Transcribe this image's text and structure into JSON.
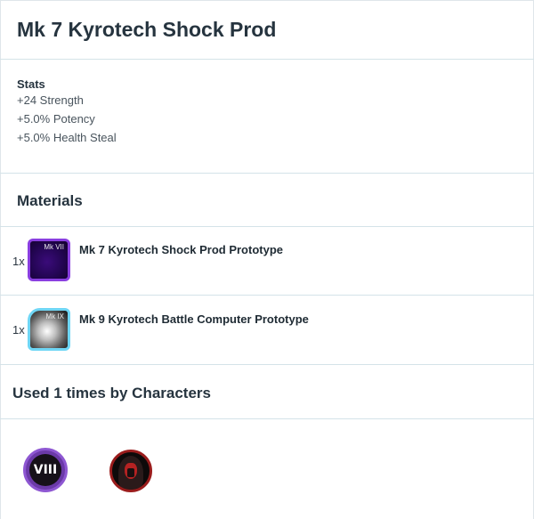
{
  "item": {
    "title": "Mk 7 Kyrotech Shock Prod"
  },
  "stats": {
    "heading": "Stats",
    "lines": [
      "+24 Strength",
      "+5.0% Potency",
      "+5.0% Health Steal"
    ]
  },
  "materials": {
    "heading": "Materials",
    "items": [
      {
        "quantity": "1x",
        "tier": "Mk VII",
        "name": "Mk 7 Kyrotech Shock Prod Prototype",
        "icon": "purple-gear-icon",
        "border_color": "#8a3fe0"
      },
      {
        "quantity": "1x",
        "tier": "Mk IX",
        "name": "Mk 9 Kyrotech Battle Computer Prototype",
        "icon": "blue-gear-icon",
        "border_color": "#6fd6f5"
      }
    ]
  },
  "used_by": {
    "heading": "Used 1 times by Characters",
    "characters": [
      {
        "badge": "VIII",
        "icon": "gear-tier-viii-icon",
        "color": "#8e57d2"
      },
      {
        "icon": "darth-revan-portrait-icon",
        "color": "#9a1c1c"
      }
    ]
  }
}
